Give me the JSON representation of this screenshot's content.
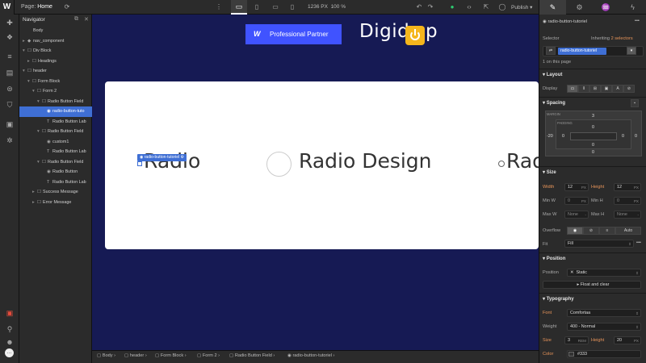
{
  "topbar": {
    "logo": "W",
    "page_prefix": "Page:",
    "page_name": "Home",
    "canvas_width": "1236 PX",
    "zoom": "100 %",
    "publish_label": "Publish"
  },
  "navigator": {
    "title": "Navigator",
    "items": [
      {
        "label": "Body",
        "caret": "",
        "icon": ""
      },
      {
        "label": "nav_component",
        "caret": "▸",
        "icon": "◆"
      },
      {
        "label": "Div Block",
        "caret": "▾",
        "icon": "☐"
      },
      {
        "label": "Headings",
        "caret": "▸",
        "icon": "☐"
      },
      {
        "label": "header",
        "caret": "▾",
        "icon": "☐"
      },
      {
        "label": "Form Block",
        "caret": "▾",
        "icon": "☐"
      },
      {
        "label": "Form 2",
        "caret": "▾",
        "icon": "☐"
      },
      {
        "label": "Radio Button Field",
        "caret": "▾",
        "icon": "☐"
      },
      {
        "label": "radio-button-tuto",
        "caret": "",
        "icon": "◉"
      },
      {
        "label": "Radio Button Lab",
        "caret": "",
        "icon": "T"
      },
      {
        "label": "Radio Button Field",
        "caret": "▾",
        "icon": "☐"
      },
      {
        "label": "custom1",
        "caret": "",
        "icon": "◉"
      },
      {
        "label": "Radio Button Lab",
        "caret": "",
        "icon": "T"
      },
      {
        "label": "Radio Button Field",
        "caret": "▾",
        "icon": "☐"
      },
      {
        "label": "Radio Button",
        "caret": "",
        "icon": "◉"
      },
      {
        "label": "Radio Button Lab",
        "caret": "",
        "icon": "T"
      },
      {
        "label": "Success Message",
        "caret": "▸",
        "icon": "☐"
      },
      {
        "label": "Error Message",
        "caret": "▸",
        "icon": "☐"
      }
    ]
  },
  "canvas": {
    "partner_mark": "W",
    "partner_label": "Professional Partner",
    "brand_start": "Digid",
    "brand_end": "p",
    "radio_1": "Radio",
    "radio_2": "Radio Design",
    "radio_3": "Rad",
    "selected_tag": "radio-button-tutoriel"
  },
  "breadcrumb": [
    "Body",
    "header",
    "Form Block",
    "Form 2",
    "Radio Button Field",
    "radio-button-tutoriel"
  ],
  "rpanel": {
    "element_name": "radio-button-tutoriel",
    "selector_label": "Selector",
    "inheriting_prefix": "Inheriting",
    "inheriting_link": "2 selectors",
    "selector_chip": "radio-button-tutoriel",
    "on_page": "1 on this page",
    "layout": {
      "title": "Layout",
      "display_label": "Display"
    },
    "spacing": {
      "title": "Spacing",
      "margin_label": "MARGIN",
      "padding_label": "PADDING",
      "margin_top": "3",
      "margin_left": "-20",
      "margin_right": "0",
      "margin_bottom": "0",
      "padding_top": "0",
      "padding_left": "0",
      "padding_right": "0",
      "padding_bottom": "0"
    },
    "size": {
      "title": "Size",
      "width_label": "Width",
      "width_value": "12",
      "width_unit": "PX",
      "height_label": "Height",
      "height_value": "12",
      "height_unit": "PX",
      "minw_label": "Min W",
      "minw_value": "0",
      "minw_unit": "PX",
      "minh_label": "Min H",
      "minh_value": "0",
      "minh_unit": "PX",
      "maxw_label": "Max W",
      "maxw_value": "None",
      "maxw_unit": "-",
      "maxh_label": "Max H",
      "maxh_value": "None",
      "maxh_unit": "-",
      "overflow_label": "Overflow",
      "overflow_auto": "Auto",
      "fit_label": "Fit",
      "fit_value": "Fill"
    },
    "position": {
      "title": "Position",
      "label": "Position",
      "value": "Static",
      "float_label": "Float and clear"
    },
    "typography": {
      "title": "Typography",
      "font_label": "Font",
      "font_value": "Comfortaa",
      "weight_label": "Weight",
      "weight_value": "400 - Normal",
      "size_label": "Size",
      "size_value": "3",
      "size_unit": "REM",
      "height_label": "Height",
      "height_value": "20",
      "height_unit": "PX",
      "color_label": "Color",
      "color_value": "#333"
    }
  },
  "colors": {
    "canvas_bg": "#161a54",
    "partner_blue": "#4053ff",
    "brand_yellow": "#f5b61c",
    "selection_blue": "#3f6fd4",
    "highlight_orange": "#e8955a"
  }
}
